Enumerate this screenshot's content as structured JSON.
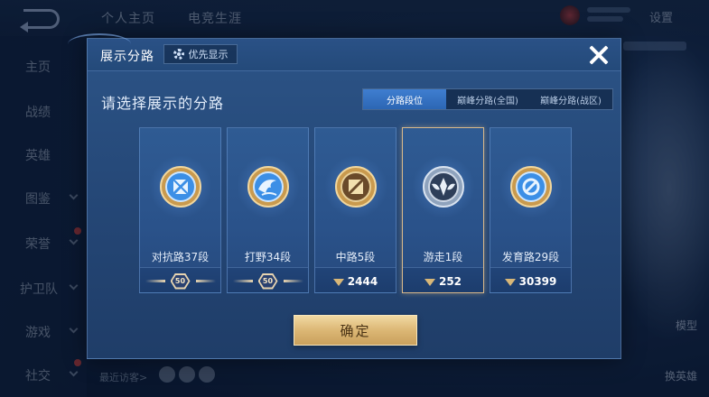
{
  "background": {
    "top_tabs": [
      "个人主页",
      "电竞生涯"
    ],
    "settings": "设置",
    "side_nav": [
      {
        "label": "主页"
      },
      {
        "label": "战绩"
      },
      {
        "label": "英雄"
      },
      {
        "label": "图鉴"
      },
      {
        "label": "荣誉"
      },
      {
        "label": "护卫队"
      },
      {
        "label": "游戏"
      },
      {
        "label": "社交"
      }
    ],
    "recent_visitors": "最近访客>",
    "right_labels": [
      "模型",
      "换英雄"
    ]
  },
  "modal": {
    "title": "展示分路",
    "priority_button": "优先显示",
    "subtitle": "请选择展示的分路",
    "tabs": [
      {
        "label": "分路段位",
        "active": true
      },
      {
        "label": "巅峰分路(全国)",
        "active": false
      },
      {
        "label": "巅峰分路(战区)",
        "active": false
      }
    ],
    "cards": [
      {
        "label": "对抗路37段",
        "footer_type": "star",
        "star_value": "50",
        "emblem": "crossed-swords-emblem-icon",
        "selected": false
      },
      {
        "label": "打野34段",
        "footer_type": "star",
        "star_value": "50",
        "emblem": "dragon-emblem-icon",
        "selected": false
      },
      {
        "label": "中路5段",
        "footer_type": "points",
        "points": "2444",
        "emblem": "slash-emblem-icon",
        "selected": false
      },
      {
        "label": "游走1段",
        "footer_type": "points",
        "points": "252",
        "emblem": "support-wings-emblem-icon",
        "selected": true
      },
      {
        "label": "发育路29段",
        "footer_type": "points",
        "points": "30399",
        "emblem": "target-emblem-icon",
        "selected": false
      }
    ],
    "confirm_button": "确定"
  },
  "colors": {
    "accent_gold": "#dcb775",
    "tab_active": "#3f7ed0",
    "card_border_selected": "#d9b98a"
  }
}
